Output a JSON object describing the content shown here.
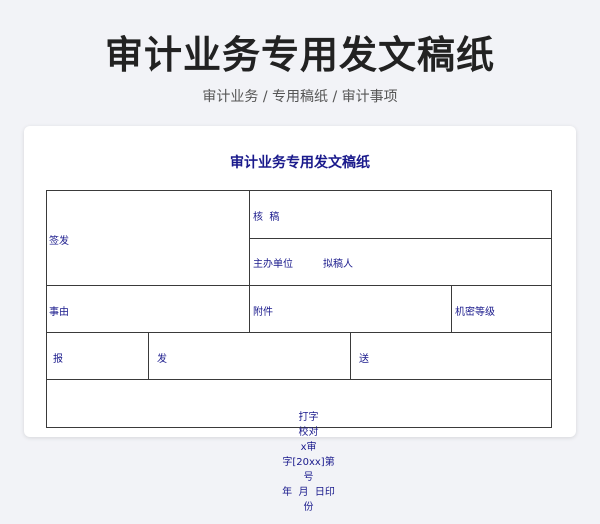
{
  "header": {
    "title": "审计业务专用发文稿纸",
    "breadcrumb": "审计业务 / 专用稿纸 / 审计事项"
  },
  "form": {
    "title": "审计业务专用发文稿纸",
    "fields": {
      "signoff": "签发",
      "review": "核  稿",
      "sponsor_unit": "主办单位",
      "drafter": "拟稿人",
      "subject": "事由",
      "attachment": "附件",
      "secrecy_level": "机密等级",
      "report": "报",
      "send": "发",
      "deliver": "送"
    },
    "footer": {
      "typing": "打字",
      "proofread": "校对",
      "xshen": "x审",
      "doc_no": "字[20xx]第",
      "hao": "号",
      "date": "年  月  日印",
      "copies": "份"
    }
  },
  "colors": {
    "background": "#f2f3f7",
    "card": "#ffffff",
    "form_text": "#1a1a8c",
    "grid_line": "#3a3a3a"
  }
}
